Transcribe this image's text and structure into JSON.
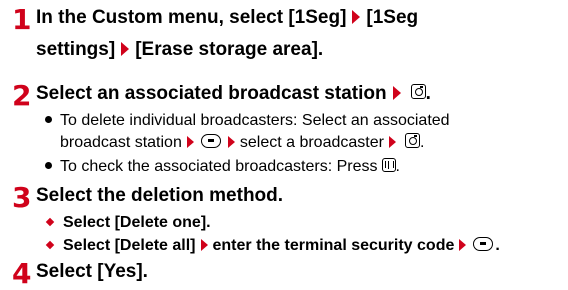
{
  "steps": [
    {
      "num": "1",
      "line1": {
        "pre": "In the Custom menu, select [1Seg]",
        "mid": "[1Seg"
      },
      "line2": {
        "pre": "settings]",
        "post": "[Erase storage area]."
      }
    },
    {
      "num": "2",
      "text": {
        "pre": "Select an associated broadcast station",
        "post": "."
      },
      "bullets": [
        {
          "a": "To delete individual broadcasters: Select an associated",
          "b": "broadcast station",
          "c": "select a broadcaster",
          "d": "."
        },
        {
          "a": "To check the associated broadcasters: Press",
          "d": "."
        }
      ]
    },
    {
      "num": "3",
      "text": "Select the deletion method.",
      "options": [
        {
          "a": "Select [Delete one]."
        },
        {
          "a": "Select [Delete all]",
          "b": "enter the terminal security code",
          "d": "."
        }
      ]
    },
    {
      "num": "4",
      "text": "Select [Yes]."
    }
  ],
  "icons": {
    "arrow": "triangle-right",
    "camera_key": "camera-key",
    "center_key": "center-key",
    "book_key": "phonebook-key"
  },
  "colors": {
    "accent": "#d0021b"
  }
}
